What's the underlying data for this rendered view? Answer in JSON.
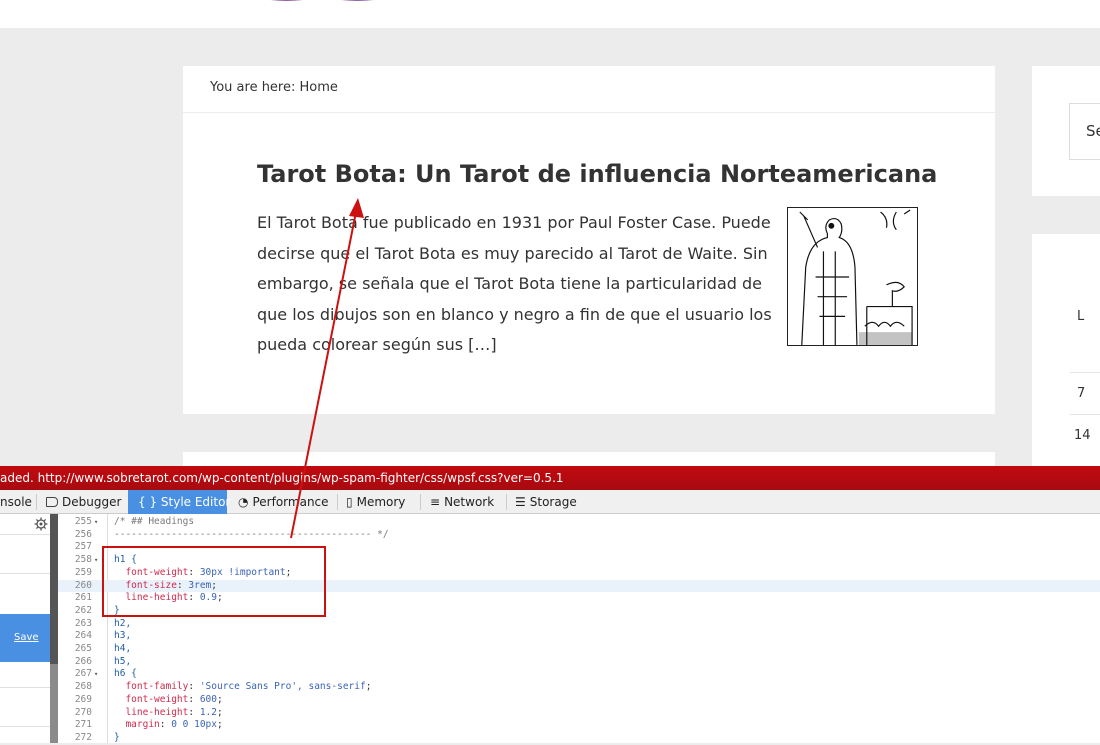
{
  "page": {
    "breadcrumb": "You are here: Home",
    "post_title": "Tarot Bota: Un Tarot de influencia Norteamericana",
    "excerpt_lines": [
      "El Tarot Bota fue publicado en 1931 por Paul Foster Case.  Puede",
      "decirse que el Tarot Bota es muy parecido al Tarot de Waite.  Sin",
      "embargo, se señala que el Tarot Bota tiene la particularidad de",
      "que los dibujos son en blanco y negro a fin de que el usuario los",
      "pueda colorear según sus […]"
    ],
    "search_text": "Se",
    "calendar": {
      "header": "L",
      "row1": "7",
      "row2": "14"
    }
  },
  "devtools": {
    "notification": "aded. http://www.sobretarot.com/wp-content/plugins/wp-spam-fighter/css/wpsf.css?ver=0.5.1",
    "tabs": [
      {
        "label": "nsole",
        "icon": ""
      },
      {
        "label": "Debugger",
        "icon": "debugger-icon"
      },
      {
        "label": "{ } Style Editor",
        "icon": ""
      },
      {
        "label": "Performance",
        "icon": "performance-icon"
      },
      {
        "label": "Memory",
        "icon": "memory-icon"
      },
      {
        "label": "Network",
        "icon": "network-icon"
      },
      {
        "label": "Storage",
        "icon": "storage-icon"
      }
    ],
    "active_tab": "{ } Style Editor",
    "save_label": "Save",
    "code_lines": [
      {
        "n": "255",
        "fold": "▾",
        "text": "/* ## Headings"
      },
      {
        "n": "256",
        "fold": "",
        "text": "--------------------------------------------- */"
      },
      {
        "n": "257",
        "fold": "",
        "text": ""
      },
      {
        "n": "258",
        "fold": "▾",
        "text": "h1 {"
      },
      {
        "n": "259",
        "fold": "",
        "text": "  font-weight: 30px !important;"
      },
      {
        "n": "260",
        "fold": "",
        "text": "  font-size: 3rem;"
      },
      {
        "n": "261",
        "fold": "",
        "text": "  line-height: 0.9;"
      },
      {
        "n": "262",
        "fold": "",
        "text": "}"
      },
      {
        "n": "263",
        "fold": "",
        "text": "h2,"
      },
      {
        "n": "264",
        "fold": "",
        "text": "h3,"
      },
      {
        "n": "265",
        "fold": "",
        "text": "h4,"
      },
      {
        "n": "266",
        "fold": "",
        "text": "h5,"
      },
      {
        "n": "267",
        "fold": "▾",
        "text": "h6 {"
      },
      {
        "n": "268",
        "fold": "",
        "text": "  font-family: 'Source Sans Pro', sans-serif;"
      },
      {
        "n": "269",
        "fold": "",
        "text": "  font-weight: 600;"
      },
      {
        "n": "270",
        "fold": "",
        "text": "  line-height: 1.2;"
      },
      {
        "n": "271",
        "fold": "",
        "text": "  margin: 0 0 10px;"
      },
      {
        "n": "272",
        "fold": "",
        "text": "}"
      }
    ]
  },
  "colors": {
    "notification_bg": "#b1090e",
    "active_tab": "#4a90e2",
    "annotation": "#cc1111"
  }
}
